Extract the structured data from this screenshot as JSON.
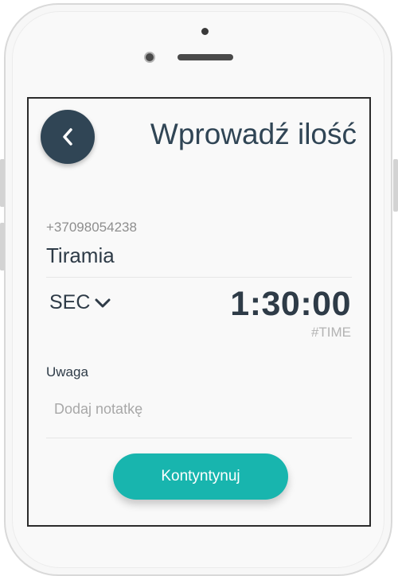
{
  "header": {
    "back_icon": "chevron-left-icon",
    "title": "Wprowadź ilość"
  },
  "recipient": {
    "phone": "+37098054238",
    "name": "Tiramia"
  },
  "amount": {
    "unit_selected": "SEC",
    "unit_icon": "chevron-down-icon",
    "value": "1:30:00",
    "value_type": "#TIME"
  },
  "note": {
    "label": "Uwaga",
    "value": "",
    "placeholder": "Dodaj notatkę"
  },
  "actions": {
    "continue_label": "Kontyntynuj"
  },
  "colors": {
    "accent": "#18b5ae",
    "primary_dark": "#304555",
    "text_dark": "#2e3b47",
    "text_muted": "#8e8e8e"
  }
}
